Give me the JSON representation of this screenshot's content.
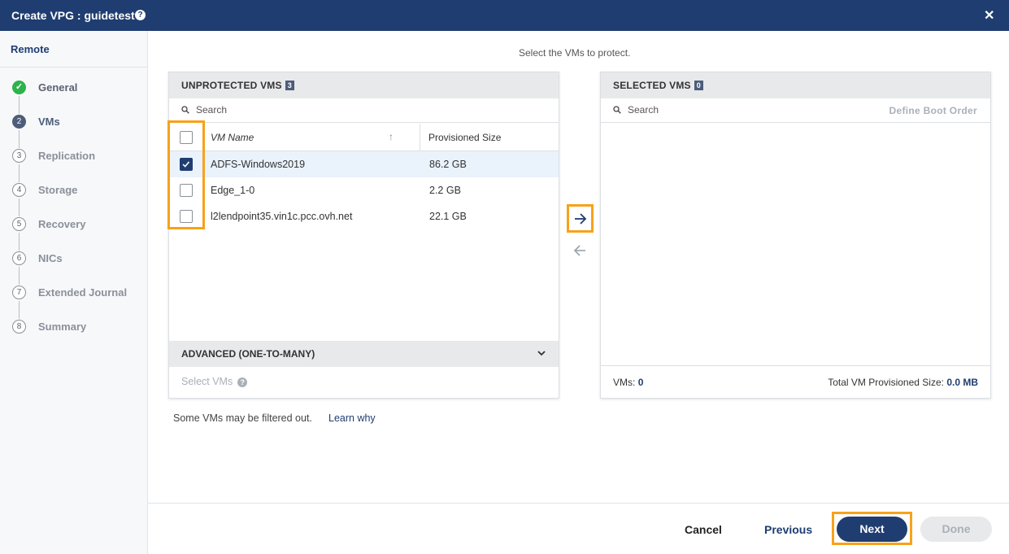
{
  "window": {
    "title": "Create VPG : guidetest",
    "help_glyph": "?",
    "close_glyph": "✕"
  },
  "sidebar": {
    "section": "Remote",
    "steps": [
      {
        "num": "✓",
        "label": "General",
        "state": "done"
      },
      {
        "num": "2",
        "label": "VMs",
        "state": "active"
      },
      {
        "num": "3",
        "label": "Replication",
        "state": "todo"
      },
      {
        "num": "4",
        "label": "Storage",
        "state": "todo"
      },
      {
        "num": "5",
        "label": "Recovery",
        "state": "todo"
      },
      {
        "num": "6",
        "label": "NICs",
        "state": "todo"
      },
      {
        "num": "7",
        "label": "Extended Journal",
        "state": "todo"
      },
      {
        "num": "8",
        "label": "Summary",
        "state": "todo"
      }
    ]
  },
  "main": {
    "instruction": "Select the VMs to protect.",
    "unprotected": {
      "title": "UNPROTECTED VMS",
      "count": "3",
      "search_placeholder": "Search",
      "col_name": "VM Name",
      "col_size": "Provisioned Size",
      "sort_glyph": "↑",
      "rows": [
        {
          "name": "ADFS-Windows2019",
          "size": "86.2 GB",
          "checked": true
        },
        {
          "name": "Edge_1-0",
          "size": "2.2 GB",
          "checked": false
        },
        {
          "name": "l2lendpoint35.vin1c.pcc.ovh.net",
          "size": "22.1 GB",
          "checked": false
        }
      ],
      "advanced_title": "ADVANCED (ONE-TO-MANY)",
      "select_vms": "Select VMs",
      "select_vms_help": "?"
    },
    "selected": {
      "title": "SELECTED VMS",
      "count": "0",
      "search_placeholder": "Search",
      "define_boot_order": "Define Boot Order",
      "vms_label": "VMs:",
      "vms_value": "0",
      "total_label": "Total VM Provisioned Size:",
      "total_value": "0.0 MB"
    },
    "filter_note": "Some VMs may be filtered out.",
    "learn_why": "Learn why"
  },
  "footer": {
    "cancel": "Cancel",
    "previous": "Previous",
    "next": "Next",
    "done": "Done"
  },
  "colors": {
    "brand": "#1f3d70",
    "highlight": "#f7a21b",
    "success": "#2db34a"
  }
}
